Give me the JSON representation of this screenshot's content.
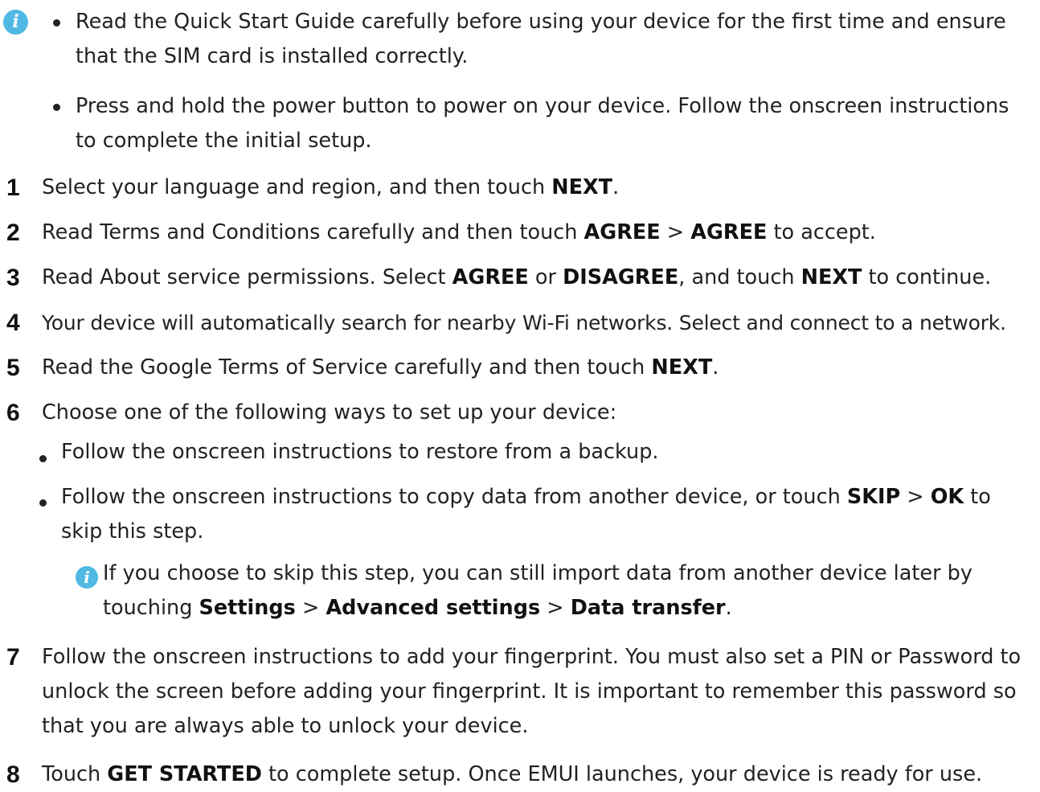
{
  "notes": {
    "bullet_1": "Read the Quick Start Guide carefully before using your device for the first time and ensure that the SIM card is installed correctly.",
    "bullet_2": "Press and hold the power button to power on your device. Follow the onscreen instructions to complete the initial setup."
  },
  "steps": [
    {
      "num": "1",
      "pre": "Select your language and region, and then touch ",
      "b1": "NEXT",
      "post": "."
    },
    {
      "num": "2",
      "pre": "Read Terms and Conditions carefully and then touch ",
      "b1": "AGREE",
      "sep": " > ",
      "b2": "AGREE",
      "post": " to accept."
    },
    {
      "num": "3",
      "pre": "Read About service permissions. Select ",
      "b1": "AGREE",
      "mid": " or ",
      "b2": "DISAGREE",
      "mid2": ", and touch ",
      "b3": "NEXT",
      "post": " to continue."
    },
    {
      "num": "4",
      "text": "Your device will automatically search for nearby Wi-Fi networks. Select and connect to a network."
    },
    {
      "num": "5",
      "pre": "Read the Google Terms of Service carefully and then touch ",
      "b1": "NEXT",
      "post": "."
    },
    {
      "num": "6",
      "text": "Choose one of the following ways to set up your device:"
    },
    {
      "num": "7",
      "text": "Follow the onscreen instructions to add your fingerprint. You must also set a PIN or Password to unlock the screen before adding your fingerprint. It is important to remember this password so that you are always able to unlock your device."
    },
    {
      "num": "8",
      "pre": "Touch ",
      "b1": "GET STARTED",
      "post": " to complete setup. Once EMUI launches, your device is ready for use."
    }
  ],
  "step6": {
    "option_1": "Follow the onscreen instructions to restore from a backup.",
    "option_2_pre": "Follow the onscreen instructions to copy data from another device, or touch ",
    "option_2_b1": "SKIP",
    "option_2_sep": " > ",
    "option_2_b2": "OK",
    "option_2_post": " to skip this step.",
    "tip_pre": "If you choose to skip this step, you can still import data from another device later by touching ",
    "tip_b1": "Settings",
    "tip_sep1": " > ",
    "tip_b2": "Advanced settings",
    "tip_sep2": " > ",
    "tip_b3": "Data transfer",
    "tip_post": "."
  },
  "icons": {
    "info_glyph": "i",
    "info_color": "#4fb8e3"
  }
}
